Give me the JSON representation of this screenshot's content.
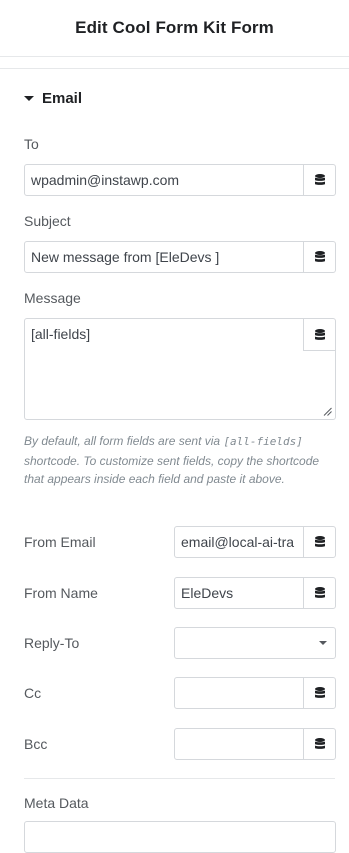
{
  "header": {
    "title": "Edit Cool Form Kit Form"
  },
  "section": {
    "title": "Email",
    "icon": "caret-down-icon"
  },
  "to": {
    "label": "To",
    "value": "wpadmin@instawp.com"
  },
  "subject": {
    "label": "Subject",
    "value": "New message from [EleDevs ]"
  },
  "message": {
    "label": "Message",
    "value": "[all-fields]"
  },
  "note": {
    "before": "By default, all form fields are sent via ",
    "code": "[all-fields]",
    "after": " shortcode. To customize sent fields, copy the shortcode that appears inside each field and paste it above."
  },
  "from_email": {
    "label": "From Email",
    "value": "email@local-ai-tra"
  },
  "from_name": {
    "label": "From Name",
    "value": "EleDevs"
  },
  "reply_to": {
    "label": "Reply-To",
    "value": ""
  },
  "cc": {
    "label": "Cc",
    "value": ""
  },
  "bcc": {
    "label": "Bcc",
    "value": ""
  },
  "meta": {
    "label": "Meta Data"
  },
  "icons": {
    "dynamic_tags": "database-icon",
    "resize": "resize-handle-icon",
    "select": "chevron-down-icon"
  }
}
